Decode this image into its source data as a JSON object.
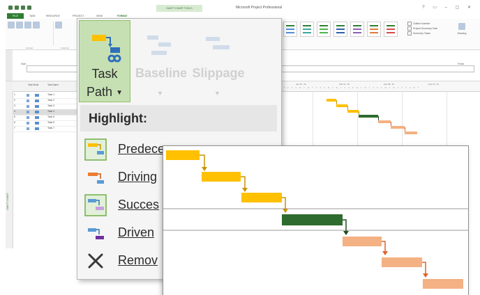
{
  "app": {
    "window_title": "Microsoft Project Professional",
    "context_tab_group": "GANTT CHART TOOLS"
  },
  "ribbon": {
    "tabs": [
      "FILE",
      "TASK",
      "RESOURCE",
      "PROJECT",
      "VIEW",
      "FORMAT"
    ],
    "active_tab": "FORMAT",
    "groups": [
      "Format",
      "Columns",
      "Bar Styles",
      "Gantt Chart Style",
      "Show/Hide",
      "Drawings"
    ],
    "checkboxes": [
      "Outline Number",
      "Project Summary Task",
      "Summary Tasks"
    ],
    "drawing_label": "Drawing"
  },
  "timeline": {
    "start_label": "Start",
    "finish_label": "Finish",
    "side_label": "TIMELINE"
  },
  "grid": {
    "side_label": "GANTT CHART",
    "columns": [
      "",
      "Task Mode",
      "Task Name"
    ],
    "rows": [
      {
        "id": "1",
        "name": "Task 1"
      },
      {
        "id": "2",
        "name": "Task 2"
      },
      {
        "id": "3",
        "name": "Task 3"
      },
      {
        "id": "4",
        "name": "Task 4"
      },
      {
        "id": "5",
        "name": "Task 5"
      },
      {
        "id": "6",
        "name": "Task 6"
      },
      {
        "id": "7",
        "name": "Task 7"
      }
    ],
    "selected_row": 3
  },
  "chart": {
    "dates": [
      "Jan 25, '15",
      "Feb 01, '15",
      "Feb 08, '15",
      "Feb 15, '15"
    ],
    "day_letters": "W T F S S M T W T F S S M T W T F S S M T W T F S S M T W T F S S M T",
    "colors": {
      "predecessor": "#ffc000",
      "predecessor_arrow": "#c89400",
      "selected": "#2e6b2e",
      "selected_arrow": "#1e4d1e",
      "successor": "#f4b183",
      "successor_arrow": "#e0622a"
    }
  },
  "task_path_menu": {
    "button_line1": "Task",
    "button_line2": "Path",
    "ghost_buttons": [
      "Baseline",
      "Slippage"
    ],
    "section_header": "Highlight:",
    "items": [
      {
        "label": "Predecessors",
        "icon": "predecessors-icon"
      },
      {
        "label": "Driving",
        "icon": "driving-predecessors-icon"
      },
      {
        "label": "Succes",
        "icon": "successors-icon"
      },
      {
        "label": "Driven",
        "icon": "driven-successors-icon"
      },
      {
        "label": "Remov",
        "icon": "remove-highlight-icon"
      }
    ]
  }
}
